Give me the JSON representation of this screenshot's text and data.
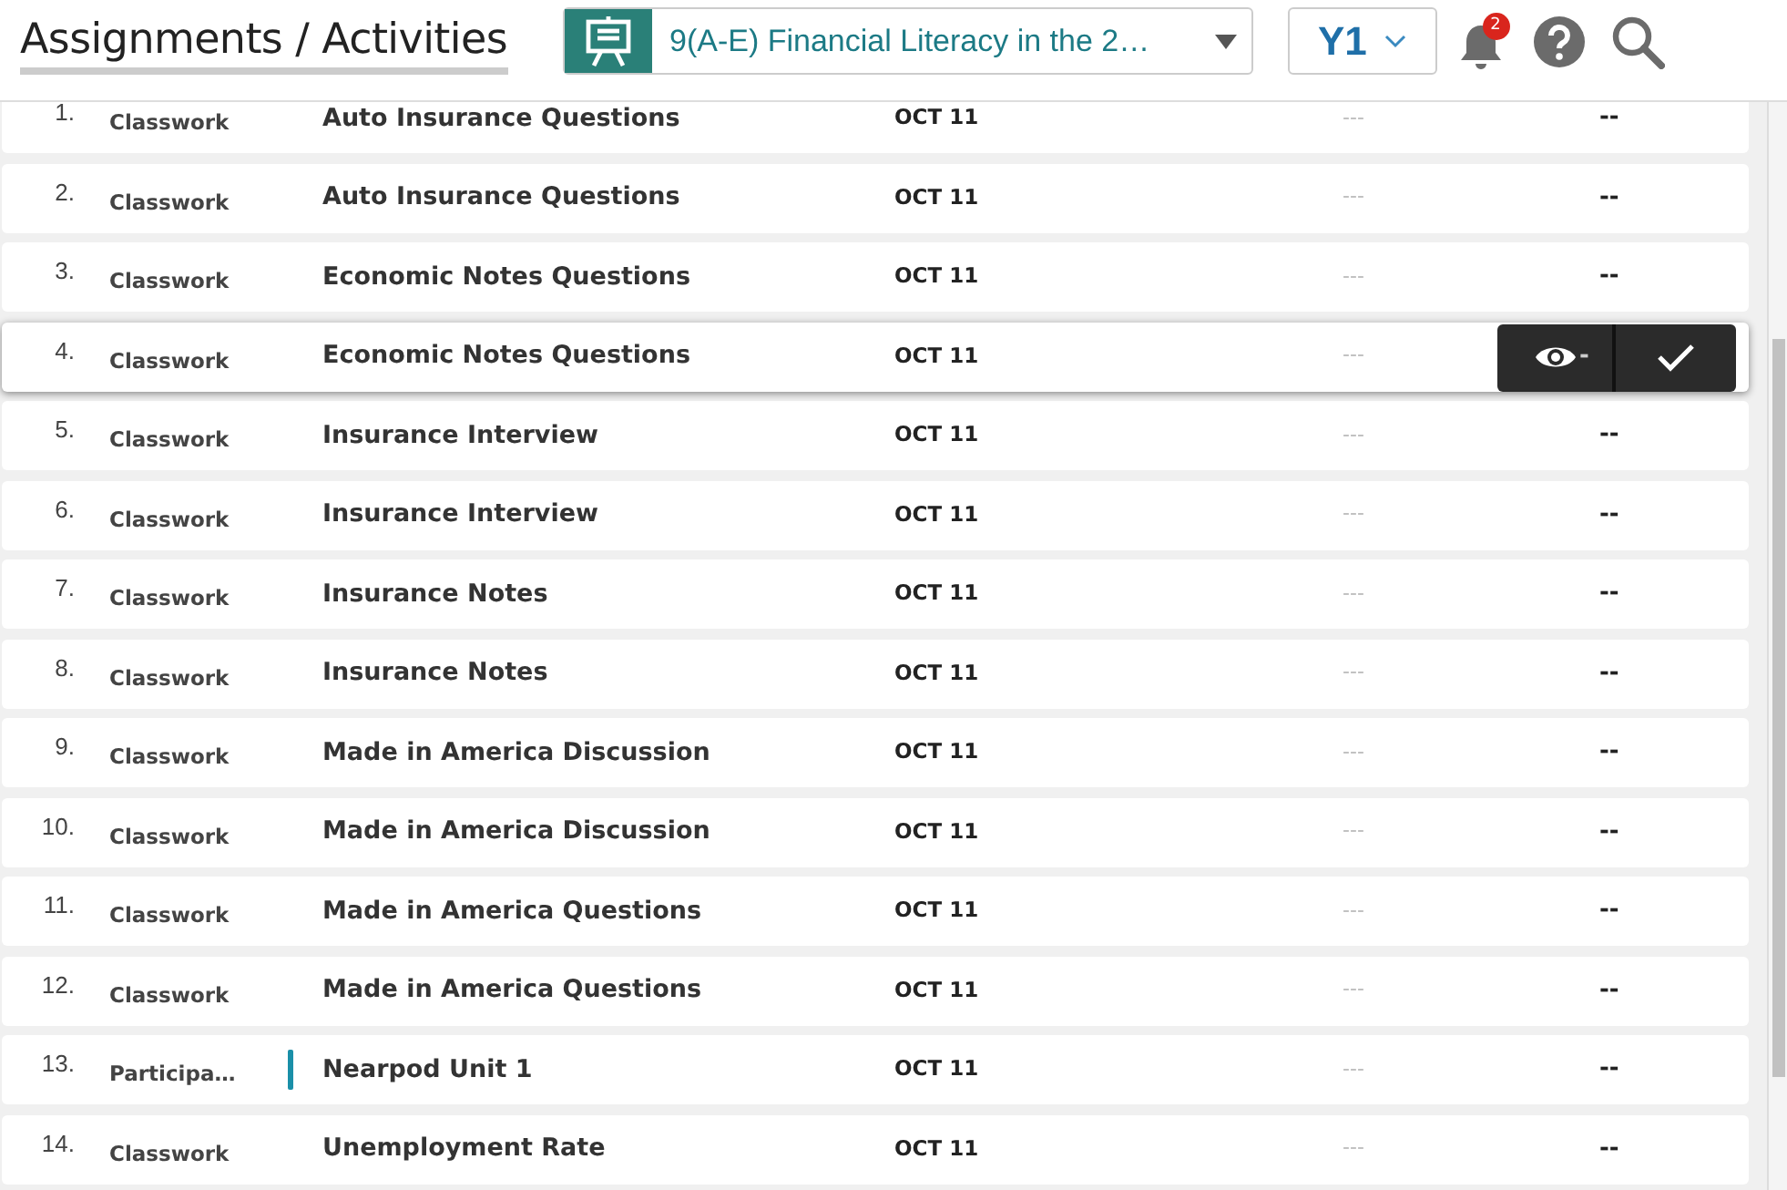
{
  "header": {
    "title": "Assignments / Activities",
    "class_selector": {
      "value": "9(A-E) Financial Literacy in the 2…"
    },
    "term_selector": {
      "value": "Y1"
    },
    "notifications": {
      "count": "2"
    }
  },
  "rows": [
    {
      "number": "1.",
      "category": "Classwork",
      "title": "Auto Insurance Questions",
      "date": "OCT 11",
      "column_5": "---",
      "score": "--",
      "flagged": false,
      "hovered": false
    },
    {
      "number": "2.",
      "category": "Classwork",
      "title": "Auto Insurance Questions",
      "date": "OCT 11",
      "column_5": "---",
      "score": "--",
      "flagged": false,
      "hovered": false
    },
    {
      "number": "3.",
      "category": "Classwork",
      "title": "Economic Notes Questions",
      "date": "OCT 11",
      "column_5": "---",
      "score": "--",
      "flagged": false,
      "hovered": false
    },
    {
      "number": "4.",
      "category": "Classwork",
      "title": "Economic Notes Questions",
      "date": "OCT 11",
      "column_5": "---",
      "score": "-",
      "flagged": false,
      "hovered": true
    },
    {
      "number": "5.",
      "category": "Classwork",
      "title": "Insurance Interview",
      "date": "OCT 11",
      "column_5": "---",
      "score": "--",
      "flagged": false,
      "hovered": false
    },
    {
      "number": "6.",
      "category": "Classwork",
      "title": "Insurance Interview",
      "date": "OCT 11",
      "column_5": "---",
      "score": "--",
      "flagged": false,
      "hovered": false
    },
    {
      "number": "7.",
      "category": "Classwork",
      "title": "Insurance Notes",
      "date": "OCT 11",
      "column_5": "---",
      "score": "--",
      "flagged": false,
      "hovered": false
    },
    {
      "number": "8.",
      "category": "Classwork",
      "title": "Insurance Notes",
      "date": "OCT 11",
      "column_5": "---",
      "score": "--",
      "flagged": false,
      "hovered": false
    },
    {
      "number": "9.",
      "category": "Classwork",
      "title": "Made in America Discussion",
      "date": "OCT 11",
      "column_5": "---",
      "score": "--",
      "flagged": false,
      "hovered": false
    },
    {
      "number": "10.",
      "category": "Classwork",
      "title": "Made in America Discussion",
      "date": "OCT 11",
      "column_5": "---",
      "score": "--",
      "flagged": false,
      "hovered": false
    },
    {
      "number": "11.",
      "category": "Classwork",
      "title": "Made in America Questions",
      "date": "OCT 11",
      "column_5": "---",
      "score": "--",
      "flagged": false,
      "hovered": false
    },
    {
      "number": "12.",
      "category": "Classwork",
      "title": "Made in America Questions",
      "date": "OCT 11",
      "column_5": "---",
      "score": "--",
      "flagged": false,
      "hovered": false
    },
    {
      "number": "13.",
      "category": "Participa…",
      "title": "Nearpod Unit 1",
      "date": "OCT 11",
      "column_5": "---",
      "score": "--",
      "flagged": true,
      "hovered": false
    },
    {
      "number": "14.",
      "category": "Classwork",
      "title": "Unemployment Rate",
      "date": "OCT 11",
      "column_5": "---",
      "score": "--",
      "flagged": false,
      "hovered": false
    }
  ]
}
